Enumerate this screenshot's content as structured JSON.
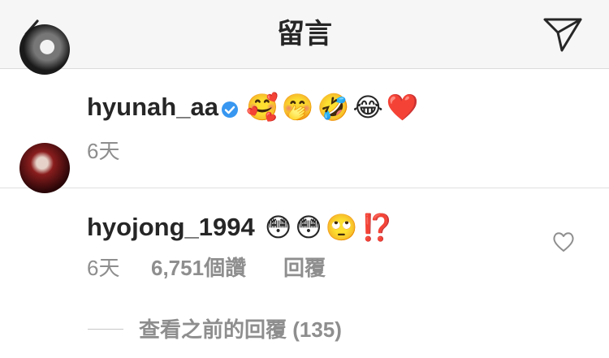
{
  "header": {
    "title": "留言",
    "back_icon": "chevron-left-icon",
    "send_icon": "paper-plane-icon"
  },
  "caption": {
    "username": "hyunah_aa",
    "verified": true,
    "emojis": "🥰🤭🤣😂❤️",
    "time": "6天"
  },
  "comment": {
    "username": "hyojong_1994",
    "emojis": "😳😳🙄⁉️",
    "time": "6天",
    "likes": "6,751個讚",
    "reply_label": "回覆",
    "heart_icon": "heart-outline-icon"
  },
  "view_replies": {
    "label": "查看之前的回覆 (135)"
  },
  "colors": {
    "verified": "#3897f0",
    "meta": "#8e8e8e",
    "header_bg": "#f6f6f6"
  }
}
